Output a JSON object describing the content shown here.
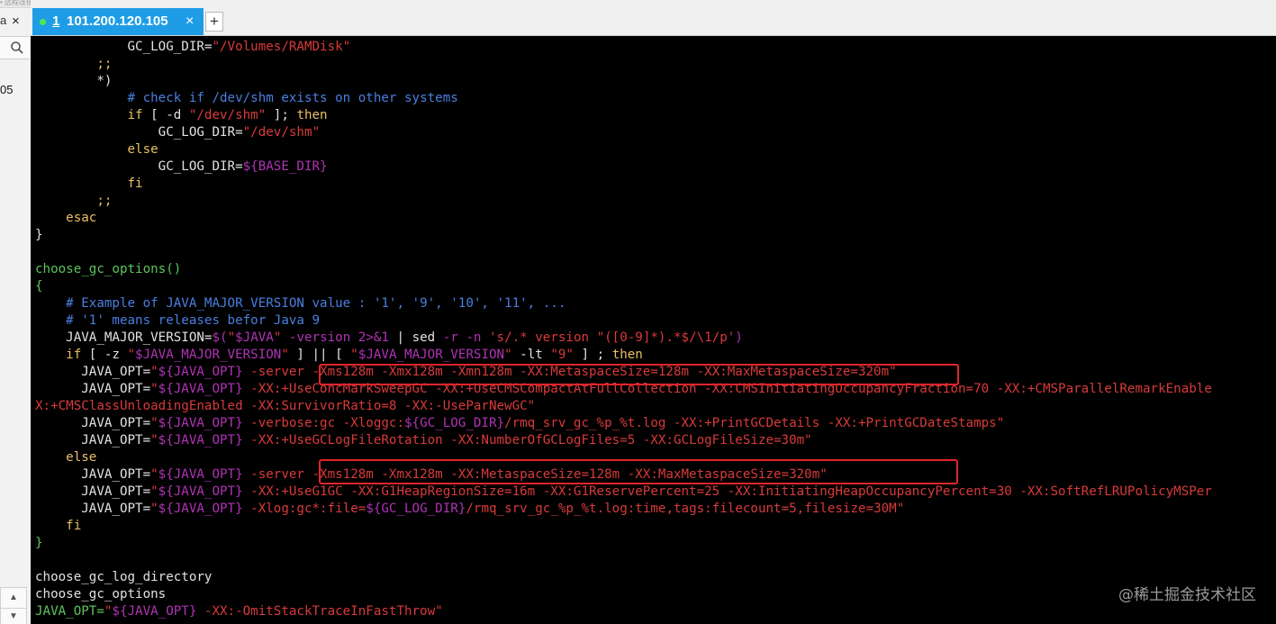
{
  "app": {
    "top_strip": "• 远程连接 101.200",
    "left_panel": {
      "close": "×",
      "mark": "a",
      "item_text": "05",
      "scroll_up": "▲",
      "scroll_down": "▼"
    }
  },
  "tab": {
    "number": "1",
    "label": "101.200.120.105",
    "close": "×",
    "add": "+"
  },
  "terminal": {
    "lines": [
      [
        [
          "w",
          "            GC_LOG_DIR="
        ],
        [
          "r",
          "\"/Volumes/RAMDisk\""
        ]
      ],
      [
        [
          "y",
          "        ;;"
        ]
      ],
      [
        [
          "w",
          "        *)"
        ]
      ],
      [
        [
          "c",
          "            # check if /dev/shm exists on other systems"
        ]
      ],
      [
        [
          "y",
          "            if"
        ],
        [
          "w",
          " [ -d "
        ],
        [
          "r",
          "\"/dev/shm\""
        ],
        [
          "w",
          " ]; "
        ],
        [
          "y",
          "then"
        ]
      ],
      [
        [
          "w",
          "                GC_LOG_DIR="
        ],
        [
          "r",
          "\"/dev/shm\""
        ]
      ],
      [
        [
          "y",
          "            else"
        ]
      ],
      [
        [
          "w",
          "                GC_LOG_DIR="
        ],
        [
          "m",
          "${BASE_DIR}"
        ]
      ],
      [
        [
          "y",
          "            fi"
        ]
      ],
      [
        [
          "y",
          "        ;;"
        ]
      ],
      [
        [
          "y",
          "    esac"
        ]
      ],
      [
        [
          "w",
          "}"
        ]
      ],
      [
        [
          "w",
          ""
        ]
      ],
      [
        [
          "g",
          "choose_gc_options()"
        ]
      ],
      [
        [
          "g",
          "{"
        ]
      ],
      [
        [
          "c",
          "    # Example of JAVA_MAJOR_VERSION value : '1', '9', '10', '11', ..."
        ]
      ],
      [
        [
          "c",
          "    # '1' means releases befor Java 9"
        ]
      ],
      [
        [
          "w",
          "    JAVA_MAJOR_VERSION="
        ],
        [
          "m",
          "$("
        ],
        [
          "r",
          "\""
        ],
        [
          "m",
          "$JAVA"
        ],
        [
          "r",
          "\""
        ],
        [
          "w",
          " "
        ],
        [
          "m",
          "-version 2>&1"
        ],
        [
          "w",
          " | "
        ],
        [
          "w",
          "sed"
        ],
        [
          "m",
          " -r -n "
        ],
        [
          "r",
          "'s/.* version \"([0-9]*).*$/\\1/p'"
        ],
        [
          "m",
          ")"
        ]
      ],
      [
        [
          "y",
          "    if"
        ],
        [
          "w",
          " [ -z "
        ],
        [
          "r",
          "\""
        ],
        [
          "m",
          "$JAVA_MAJOR_VERSION"
        ],
        [
          "r",
          "\""
        ],
        [
          "w",
          " ] || [ "
        ],
        [
          "r",
          "\""
        ],
        [
          "m",
          "$JAVA_MAJOR_VERSION"
        ],
        [
          "r",
          "\""
        ],
        [
          "w",
          " -lt "
        ],
        [
          "r",
          "\"9\""
        ],
        [
          "w",
          " ] ; "
        ],
        [
          "y",
          "then"
        ]
      ],
      [
        [
          "w",
          "      JAVA_OPT="
        ],
        [
          "r",
          "\""
        ],
        [
          "m",
          "${JAVA_OPT}"
        ],
        [
          "r",
          " -server -Xms128m -Xmx128m -Xmn128m -XX:MetaspaceSize=128m -XX:MaxMetaspaceSize=320m\""
        ]
      ],
      [
        [
          "w",
          "      JAVA_OPT="
        ],
        [
          "r",
          "\""
        ],
        [
          "m",
          "${JAVA_OPT}"
        ],
        [
          "r",
          " -XX:+UseConcMarkSweepGC -XX:+UseCMSCompactAtFullCollection -XX:CMSInitiatingOccupancyFraction=70 -XX:+CMSParallelRemarkEnable"
        ]
      ],
      [
        [
          "r",
          "X:+CMSClassUnloadingEnabled -XX:SurvivorRatio=8 -XX:-UseParNewGC\""
        ]
      ],
      [
        [
          "w",
          "      JAVA_OPT="
        ],
        [
          "r",
          "\""
        ],
        [
          "m",
          "${JAVA_OPT}"
        ],
        [
          "r",
          " -verbose:gc -Xloggc:"
        ],
        [
          "m",
          "${GC_LOG_DIR}"
        ],
        [
          "r",
          "/rmq_srv_gc_%p_%t.log -XX:+PrintGCDetails -XX:+PrintGCDateStamps\""
        ]
      ],
      [
        [
          "w",
          "      JAVA_OPT="
        ],
        [
          "r",
          "\""
        ],
        [
          "m",
          "${JAVA_OPT}"
        ],
        [
          "r",
          " -XX:+UseGCLogFileRotation -XX:NumberOfGCLogFiles=5 -XX:GCLogFileSize=30m\""
        ]
      ],
      [
        [
          "y",
          "    else"
        ]
      ],
      [
        [
          "w",
          "      JAVA_OPT="
        ],
        [
          "r",
          "\""
        ],
        [
          "m",
          "${JAVA_OPT}"
        ],
        [
          "r",
          " -server -Xms128m -Xmx128m -XX:MetaspaceSize=128m -XX:MaxMetaspaceSize=320m\""
        ]
      ],
      [
        [
          "w",
          "      JAVA_OPT="
        ],
        [
          "r",
          "\""
        ],
        [
          "m",
          "${JAVA_OPT}"
        ],
        [
          "r",
          " -XX:+UseG1GC -XX:G1HeapRegionSize=16m -XX:G1ReservePercent=25 -XX:InitiatingHeapOccupancyPercent=30 -XX:SoftRefLRUPolicyMSPer"
        ]
      ],
      [
        [
          "w",
          "      JAVA_OPT="
        ],
        [
          "r",
          "\""
        ],
        [
          "m",
          "${JAVA_OPT}"
        ],
        [
          "r",
          " -Xlog:gc*:file="
        ],
        [
          "m",
          "${GC_LOG_DIR}"
        ],
        [
          "r",
          "/rmq_srv_gc_%p_%t.log:time,tags:filecount=5,filesize=30M\""
        ]
      ],
      [
        [
          "y",
          "    fi"
        ]
      ],
      [
        [
          "g",
          "}"
        ]
      ],
      [
        [
          "w",
          ""
        ]
      ],
      [
        [
          "w",
          "choose_gc_log_directory"
        ]
      ],
      [
        [
          "w",
          "choose_gc_options"
        ]
      ],
      [
        [
          "g",
          "JAVA_OPT="
        ],
        [
          "r",
          "\""
        ],
        [
          "m",
          "${JAVA_OPT}"
        ],
        [
          "r",
          " -XX:-OmitStackTraceInFastThrow\""
        ]
      ]
    ]
  },
  "watermark": "@稀土掘金技术社区",
  "colors": {
    "terminal_bg": "#000000",
    "tab_active": "#1e9de6",
    "highlight_box": "#e0252b"
  }
}
